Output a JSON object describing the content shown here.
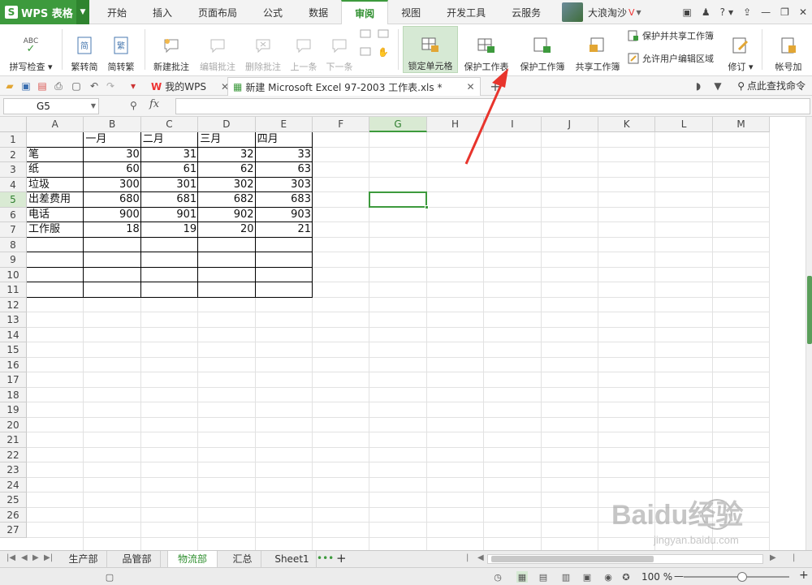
{
  "app": {
    "name": "WPS 表格"
  },
  "menu": {
    "tabs": [
      "开始",
      "插入",
      "页面布局",
      "公式",
      "数据",
      "审阅",
      "视图",
      "开发工具",
      "云服务"
    ],
    "active_index": 5
  },
  "user": {
    "name": "大浪淘沙"
  },
  "ribbon": {
    "spell_check": "拼写检查",
    "trad_to_simp": "繁转简",
    "simp_to_trad": "简转繁",
    "new_comment": "新建批注",
    "edit_comment": "编辑批注",
    "delete_comment": "删除批注",
    "prev": "上一条",
    "next": "下一条",
    "lock_cell": "锁定单元格",
    "protect_sheet": "保护工作表",
    "protect_workbook": "保护工作簿",
    "share_workbook": "共享工作簿",
    "protect_and_share": "保护并共享工作簿",
    "allow_edit_ranges": "允许用户编辑区域",
    "track_changes": "修订",
    "account": "帐号加",
    "abc": "ABC"
  },
  "doc_tabs": {
    "my_wps": "我的WPS",
    "file": "新建 Microsoft Excel 97-2003 工作表.xls *",
    "command_search": "点此查找命令"
  },
  "formula_bar": {
    "name_box": "G5",
    "fx": "fx",
    "value": ""
  },
  "columns": [
    "A",
    "B",
    "C",
    "D",
    "E",
    "F",
    "G",
    "H",
    "I",
    "J",
    "K",
    "L",
    "M"
  ],
  "selected_column": "G",
  "selected_row": 5,
  "row_numbers": [
    "1",
    "2",
    "3",
    "4",
    "5",
    "6",
    "7",
    "8",
    "9",
    "10",
    "11",
    "12",
    "13",
    "14",
    "15",
    "16",
    "17",
    "18",
    "19",
    "20",
    "21",
    "22",
    "23",
    "24",
    "25",
    "26",
    "27"
  ],
  "table": {
    "headers": [
      "",
      "一月",
      "二月",
      "三月",
      "四月"
    ],
    "rows": [
      {
        "label": "笔",
        "values": [
          30,
          31,
          32,
          33
        ]
      },
      {
        "label": "纸",
        "values": [
          60,
          61,
          62,
          63
        ]
      },
      {
        "label": "垃圾",
        "values": [
          300,
          301,
          302,
          303
        ]
      },
      {
        "label": "出差费用",
        "values": [
          680,
          681,
          682,
          683
        ]
      },
      {
        "label": "电话",
        "values": [
          900,
          901,
          902,
          903
        ]
      },
      {
        "label": "工作服",
        "values": [
          18,
          19,
          20,
          21
        ]
      }
    ]
  },
  "sheets": {
    "tabs": [
      "生产部",
      "品管部",
      "物流部",
      "汇总",
      "Sheet1"
    ],
    "active_index": 2
  },
  "status": {
    "zoom": "100 %"
  },
  "watermark": {
    "text": "Baidu经验",
    "url": "jingyan.baidu.com"
  },
  "colors": {
    "brand_green": "#3d9a3d",
    "annotation_red": "#e8342c"
  }
}
